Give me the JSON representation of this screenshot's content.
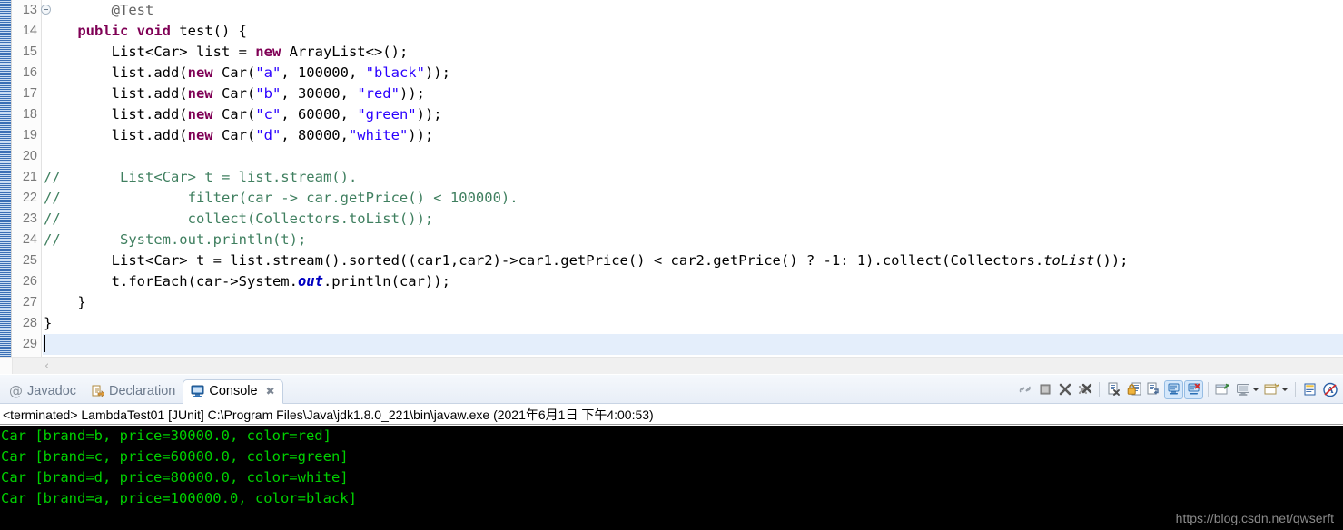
{
  "editor": {
    "lines": [
      {
        "num": "13",
        "folding": true,
        "current": false,
        "tokens": [
          {
            "t": "        ",
            "c": "plain"
          },
          {
            "t": "@Test",
            "c": "ann"
          }
        ]
      },
      {
        "num": "14",
        "folding": false,
        "current": false,
        "tokens": [
          {
            "t": "    ",
            "c": "plain"
          },
          {
            "t": "public",
            "c": "kw"
          },
          {
            "t": " ",
            "c": "plain"
          },
          {
            "t": "void",
            "c": "kw"
          },
          {
            "t": " test() {",
            "c": "plain"
          }
        ]
      },
      {
        "num": "15",
        "folding": false,
        "current": false,
        "tokens": [
          {
            "t": "        List<Car> list = ",
            "c": "plain"
          },
          {
            "t": "new",
            "c": "kw"
          },
          {
            "t": " ArrayList<>();",
            "c": "plain"
          }
        ]
      },
      {
        "num": "16",
        "folding": false,
        "current": false,
        "tokens": [
          {
            "t": "        list.add(",
            "c": "plain"
          },
          {
            "t": "new",
            "c": "kw"
          },
          {
            "t": " Car(",
            "c": "plain"
          },
          {
            "t": "\"a\"",
            "c": "str"
          },
          {
            "t": ", 100000, ",
            "c": "plain"
          },
          {
            "t": "\"black\"",
            "c": "str"
          },
          {
            "t": "));",
            "c": "plain"
          }
        ]
      },
      {
        "num": "17",
        "folding": false,
        "current": false,
        "tokens": [
          {
            "t": "        list.add(",
            "c": "plain"
          },
          {
            "t": "new",
            "c": "kw"
          },
          {
            "t": " Car(",
            "c": "plain"
          },
          {
            "t": "\"b\"",
            "c": "str"
          },
          {
            "t": ", 30000, ",
            "c": "plain"
          },
          {
            "t": "\"red\"",
            "c": "str"
          },
          {
            "t": "));",
            "c": "plain"
          }
        ]
      },
      {
        "num": "18",
        "folding": false,
        "current": false,
        "tokens": [
          {
            "t": "        list.add(",
            "c": "plain"
          },
          {
            "t": "new",
            "c": "kw"
          },
          {
            "t": " Car(",
            "c": "plain"
          },
          {
            "t": "\"c\"",
            "c": "str"
          },
          {
            "t": ", 60000, ",
            "c": "plain"
          },
          {
            "t": "\"green\"",
            "c": "str"
          },
          {
            "t": "));",
            "c": "plain"
          }
        ]
      },
      {
        "num": "19",
        "folding": false,
        "current": false,
        "tokens": [
          {
            "t": "        list.add(",
            "c": "plain"
          },
          {
            "t": "new",
            "c": "kw"
          },
          {
            "t": " Car(",
            "c": "plain"
          },
          {
            "t": "\"d\"",
            "c": "str"
          },
          {
            "t": ", 80000,",
            "c": "plain"
          },
          {
            "t": "\"white\"",
            "c": "str"
          },
          {
            "t": "));",
            "c": "plain"
          }
        ]
      },
      {
        "num": "20",
        "folding": false,
        "current": false,
        "tokens": []
      },
      {
        "num": "21",
        "folding": false,
        "current": false,
        "tokens": [
          {
            "t": "//       List<Car> t = list.stream().",
            "c": "cmt"
          }
        ]
      },
      {
        "num": "22",
        "folding": false,
        "current": false,
        "tokens": [
          {
            "t": "//               filter(car -> car.getPrice() < 100000).",
            "c": "cmt"
          }
        ]
      },
      {
        "num": "23",
        "folding": false,
        "current": false,
        "tokens": [
          {
            "t": "//               collect(Collectors.toList());",
            "c": "cmt"
          }
        ]
      },
      {
        "num": "24",
        "folding": false,
        "current": false,
        "tokens": [
          {
            "t": "//       System.out.println(t);",
            "c": "cmt"
          }
        ]
      },
      {
        "num": "25",
        "folding": false,
        "current": false,
        "tokens": [
          {
            "t": "        List<Car> t = list.stream().sorted((car1,car2)->car1.getPrice() < car2.getPrice() ? -1: 1).collect(Collectors.",
            "c": "plain"
          },
          {
            "t": "toList",
            "c": "mth"
          },
          {
            "t": "());",
            "c": "plain"
          }
        ]
      },
      {
        "num": "26",
        "folding": false,
        "current": false,
        "tokens": [
          {
            "t": "        t.forEach(car->System.",
            "c": "plain"
          },
          {
            "t": "out",
            "c": "fld"
          },
          {
            "t": ".println(car));",
            "c": "plain"
          }
        ]
      },
      {
        "num": "27",
        "folding": false,
        "current": false,
        "tokens": [
          {
            "t": "    }",
            "c": "plain"
          }
        ]
      },
      {
        "num": "28",
        "folding": false,
        "current": false,
        "tokens": [
          {
            "t": "}",
            "c": "plain"
          }
        ]
      },
      {
        "num": "29",
        "folding": false,
        "current": true,
        "caret": true,
        "tokens": []
      }
    ]
  },
  "scrollbar": {
    "left_chevron": "‹"
  },
  "console": {
    "tabs": [
      {
        "id": "javadoc",
        "label": "Javadoc",
        "icon": "at-icon",
        "active": false,
        "closable": false
      },
      {
        "id": "declaration",
        "label": "Declaration",
        "icon": "declaration-icon",
        "active": false,
        "closable": false
      },
      {
        "id": "console",
        "label": "Console",
        "icon": "console-icon",
        "active": true,
        "closable": true,
        "close_glyph": "✖"
      }
    ],
    "toolbar": [
      {
        "id": "link-with-editor",
        "name": "link-with-editor-icon",
        "toggled": false,
        "dropdown": false
      },
      {
        "id": "terminate",
        "name": "terminate-icon",
        "toggled": false,
        "dropdown": false
      },
      {
        "id": "remove-launch",
        "name": "remove-launch-icon",
        "toggled": false,
        "dropdown": false
      },
      {
        "id": "remove-all-launches",
        "name": "remove-all-launches-icon",
        "toggled": false,
        "dropdown": false
      },
      {
        "id": "separator-1",
        "name": "toolbar-separator",
        "separator": true
      },
      {
        "id": "clear-console",
        "name": "clear-console-icon",
        "toggled": false,
        "dropdown": false
      },
      {
        "id": "scroll-lock",
        "name": "scroll-lock-icon",
        "toggled": false,
        "dropdown": false
      },
      {
        "id": "word-wrap",
        "name": "word-wrap-icon",
        "toggled": false,
        "dropdown": false
      },
      {
        "id": "show-console-on-output",
        "name": "show-console-on-output-icon",
        "toggled": true,
        "dropdown": false
      },
      {
        "id": "show-console-on-error-output",
        "name": "show-console-on-error-output-icon",
        "toggled": true,
        "dropdown": false
      },
      {
        "id": "separator-2",
        "name": "toolbar-separator",
        "separator": true
      },
      {
        "id": "pin-console",
        "name": "pin-console-icon",
        "toggled": false,
        "dropdown": false
      },
      {
        "id": "display-selected-console",
        "name": "display-selected-console-icon",
        "toggled": false,
        "dropdown": true
      },
      {
        "id": "open-console",
        "name": "open-console-icon",
        "toggled": false,
        "dropdown": true
      },
      {
        "id": "separator-3",
        "name": "toolbar-separator",
        "separator": true
      },
      {
        "id": "minimize",
        "name": "minimize-icon",
        "toggled": false,
        "dropdown": false
      },
      {
        "id": "maximize",
        "name": "maximize-icon",
        "toggled": false,
        "dropdown": false
      }
    ],
    "status": "<terminated> LambdaTest01 [JUnit] C:\\Program Files\\Java\\jdk1.8.0_221\\bin\\javaw.exe (2021年6月1日 下午4:00:53)",
    "output": [
      "Car [brand=b, price=30000.0, color=red]",
      "Car [brand=c, price=60000.0, color=green]",
      "Car [brand=d, price=80000.0, color=white]",
      "Car [brand=a, price=100000.0, color=black]"
    ],
    "watermark": "https://blog.csdn.net/qwserft"
  },
  "colors": {
    "keyword": "#7f0055",
    "string": "#2a00ff",
    "comment": "#3f7f5f",
    "field": "#0000c0",
    "annotation": "#646464",
    "console_text": "#00d000",
    "console_bg": "#000000",
    "current_line": "#e4eefb"
  }
}
